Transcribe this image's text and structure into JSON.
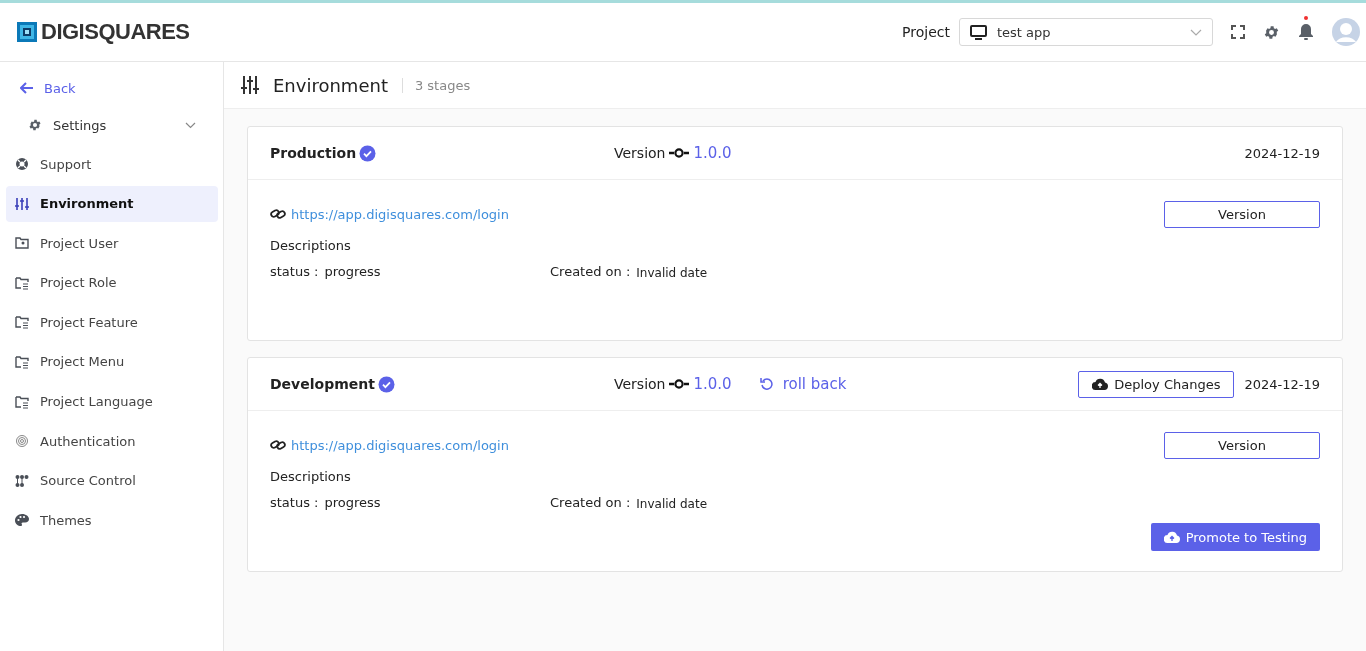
{
  "header": {
    "logo": "DIGISQUARES",
    "project_label": "Project",
    "project_value": "test app",
    "notification_dot": true
  },
  "sidebar": {
    "back": "Back",
    "settings": {
      "label": "Settings",
      "expanded": true
    },
    "items": [
      {
        "label": "Support",
        "selected": false
      },
      {
        "label": "Environment",
        "selected": true
      },
      {
        "label": "Project User",
        "selected": false
      },
      {
        "label": "Project Role",
        "selected": false
      },
      {
        "label": "Project Feature",
        "selected": false
      },
      {
        "label": "Project Menu",
        "selected": false
      },
      {
        "label": "Project Language",
        "selected": false
      },
      {
        "label": "Authentication",
        "selected": false
      },
      {
        "label": "Source Control",
        "selected": false
      },
      {
        "label": "Themes",
        "selected": false
      }
    ]
  },
  "page": {
    "title": "Environment",
    "subtitle": "3 stages"
  },
  "stages": [
    {
      "name": "Production",
      "verified": true,
      "version_label": "Version",
      "version": "1.0.0",
      "date": "2024-12-19",
      "url": "https://app.digisquares.com/login",
      "version_button": "Version",
      "description_label": "Descriptions",
      "status_label": "status :",
      "status": "progress",
      "created_label": "Created on :",
      "created": "Invalid date"
    },
    {
      "name": "Development",
      "verified": true,
      "version_label": "Version",
      "version": "1.0.0",
      "rollback": "roll back",
      "deploy": "Deploy Changes",
      "date": "2024-12-19",
      "url": "https://app.digisquares.com/login",
      "version_button": "Version",
      "description_label": "Descriptions",
      "status_label": "status :",
      "status": "progress",
      "created_label": "Created on :",
      "created": "Invalid date",
      "promote": "Promote to Testing"
    }
  ]
}
